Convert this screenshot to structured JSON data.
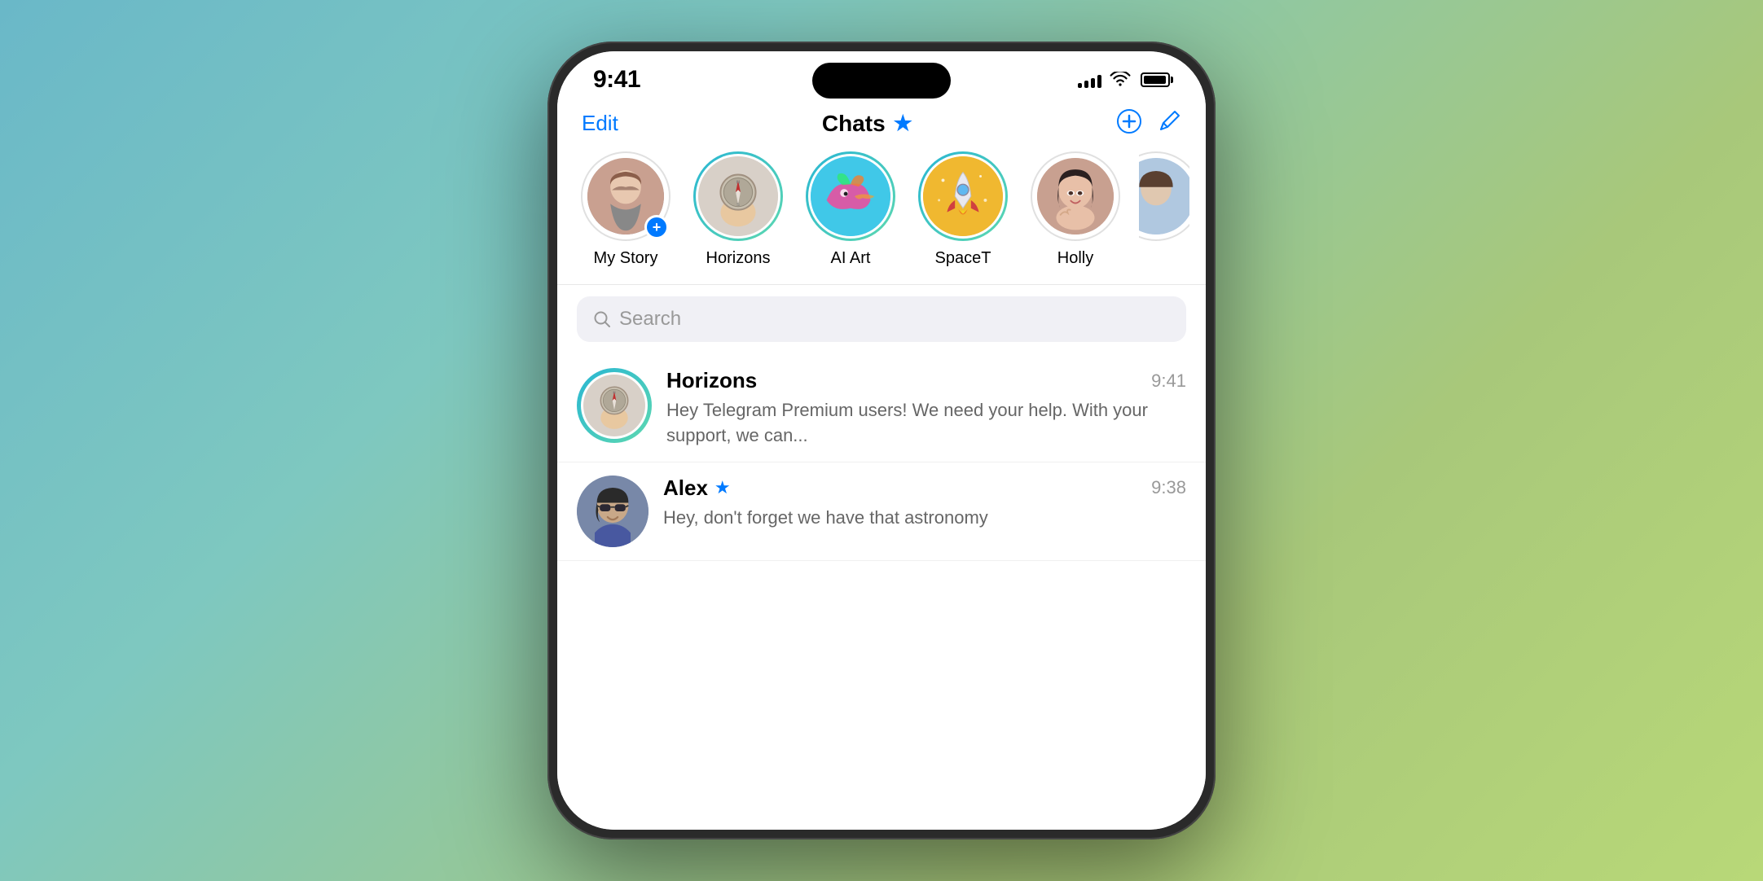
{
  "status": {
    "time": "9:41",
    "signal_bars": [
      4,
      6,
      9,
      12,
      15
    ],
    "wifi": "wifi",
    "battery": 85
  },
  "header": {
    "edit_label": "Edit",
    "title": "Chats",
    "new_group_label": "new-group",
    "compose_label": "compose"
  },
  "stories": [
    {
      "id": "my-story",
      "label": "My Story",
      "ring": false,
      "add_badge": true,
      "emoji": null
    },
    {
      "id": "horizons",
      "label": "Horizons",
      "ring": true,
      "add_badge": false,
      "emoji": "🧭"
    },
    {
      "id": "ai-art",
      "label": "AI Art",
      "ring": true,
      "add_badge": false,
      "emoji": "🦎"
    },
    {
      "id": "spacet",
      "label": "SpaceT",
      "ring": true,
      "add_badge": false,
      "emoji": "🚀"
    },
    {
      "id": "holly",
      "label": "Holly",
      "ring": false,
      "add_badge": false,
      "emoji": null
    }
  ],
  "search": {
    "placeholder": "Search"
  },
  "chats": [
    {
      "id": "horizons-chat",
      "name": "Horizons",
      "time": "9:41",
      "preview": "Hey Telegram Premium users!  We need your help. With your support, we can...",
      "has_ring": true,
      "has_star": false,
      "emoji": "🧭"
    },
    {
      "id": "alex-chat",
      "name": "Alex",
      "time": "9:38",
      "preview": "Hey, don't forget we have that astronomy",
      "has_ring": false,
      "has_star": true,
      "emoji": null
    }
  ]
}
